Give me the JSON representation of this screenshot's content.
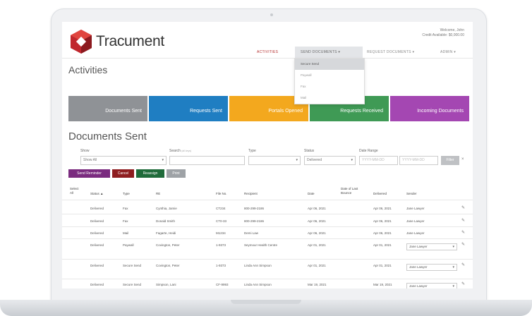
{
  "app": {
    "brand": "Tracument",
    "welcome": "Welcome, John",
    "credit": "Credit Available: $0,000.00",
    "brand_color": "#c0272d"
  },
  "nav": {
    "items": [
      {
        "label": "ACTIVITIES"
      },
      {
        "label": "SEND DOCUMENTS ▾"
      },
      {
        "label": "REQUEST DOCUMENTS ▾"
      },
      {
        "label": "ADMIN ▾"
      }
    ],
    "dropdown": [
      "Secure Send",
      "Paywall",
      "Fax",
      "Mail"
    ]
  },
  "page_title": "Activities",
  "tiles": [
    {
      "label": "Documents Sent",
      "color": "#8f9296"
    },
    {
      "label": "Requests Sent",
      "color": "#1f7ec2"
    },
    {
      "label": "Portals Opened",
      "color": "#f3a81e"
    },
    {
      "label": "Requests Received",
      "color": "#3f9a55"
    },
    {
      "label": "Incoming Documents",
      "color": "#a447b2"
    }
  ],
  "section_title": "Documents Sent",
  "filters": {
    "show_label": "Show",
    "show_value": "Show All",
    "search_label": "Search",
    "search_hint": "(all keys)",
    "type_label": "Type",
    "status_label": "Status",
    "status_value": "Delivered",
    "date_label": "Date Range",
    "date_from_placeholder": "YYYY-MM-DD",
    "date_to_placeholder": "YYYY-MM-DD",
    "filter_button": "Filter",
    "clear_icon": "×"
  },
  "actions": [
    {
      "label": "Send Reminder",
      "color": "#7a2b7f"
    },
    {
      "label": "Cancel",
      "color": "#8e1d20"
    },
    {
      "label": "Reassign",
      "color": "#1f6b3a"
    },
    {
      "label": "Print",
      "color": "#9ea2a6"
    }
  ],
  "table": {
    "select_all": [
      "Select",
      "All"
    ],
    "headers": {
      "status": "Status",
      "sort_icon": "▲",
      "type": "Type",
      "re": "RE",
      "file_no": "File No.",
      "recipient": "Recipient",
      "date": "Date",
      "last_bounce": [
        "Date of Last",
        "Bounce"
      ],
      "delivered": "Delivered",
      "sender": "Sender"
    },
    "rows": [
      {
        "status": "Delivered",
        "type": "Fax",
        "re": "Cynthia, Jamie",
        "file": "CT234",
        "recipient": "800-299-2186",
        "date": "Apr 06, 2021",
        "delivered": "Apr 06, 2021",
        "sender": "Jane Lawyer"
      },
      {
        "status": "Delivered",
        "type": "Fax",
        "re": "Donald Smith",
        "file": "CT0-33",
        "recipient": "800-299-2186",
        "date": "Apr 06, 2021",
        "delivered": "Apr 06, 2021",
        "sender": "Jane Lawyer"
      },
      {
        "status": "Delivered",
        "type": "Mail",
        "re": "Fagarte, Heidi",
        "file": "M1234",
        "recipient": "Demi Law",
        "date": "Apr 06, 2021",
        "delivered": "Apr 06, 2021",
        "sender": "Jane Lawyer"
      },
      {
        "status": "Delivered",
        "type": "Paywall",
        "re": "Covington, Peter",
        "file": "1-9373",
        "recipient": "Seymour Health Centre",
        "date": "Apr 01, 2021",
        "delivered": "Apr 01, 2021",
        "sender": "Jane Lawyer"
      },
      {
        "status": "Delivered",
        "type": "Secure Send",
        "re": "Covington, Peter",
        "file": "1-9373",
        "recipient": "Linda Ann Simpson",
        "date": "Apr 01, 2021",
        "delivered": "Apr 01, 2021",
        "sender": "Jane Lawyer"
      },
      {
        "status": "Delivered",
        "type": "Secure Send",
        "re": "Simpson, Lani",
        "file": "CF-9993",
        "recipient": "Linda Ann Simpson",
        "date": "Mar 19, 2021",
        "delivered": "Mar 19, 2021",
        "sender": "Jane Lawyer"
      }
    ]
  }
}
